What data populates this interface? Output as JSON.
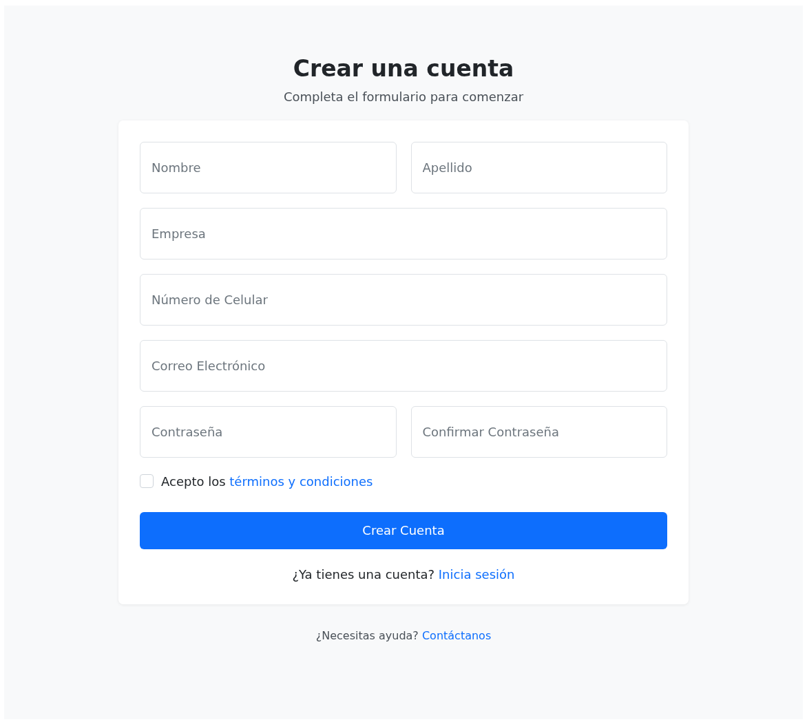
{
  "title": "Crear una cuenta",
  "subtitle": "Completa el formulario para comenzar",
  "form": {
    "rows": [
      [
        {
          "placeholder": "Nombre"
        },
        {
          "placeholder": "Apellido"
        }
      ],
      [
        {
          "placeholder": "Empresa"
        }
      ],
      [
        {
          "placeholder": "Número de Celular"
        }
      ],
      [
        {
          "placeholder": "Correo Electrónico"
        }
      ],
      [
        {
          "placeholder": "Contraseña"
        },
        {
          "placeholder": "Confirmar Contraseña"
        }
      ]
    ],
    "terms": {
      "checked": false,
      "text": "Acepto los",
      "link": "términos y condiciones"
    },
    "submit": "Crear Cuenta",
    "login": {
      "text": "¿Ya tienes una cuenta?",
      "link": "Inicia sesión"
    }
  },
  "footer": {
    "text": "¿Necesitas ayuda?",
    "link": "Contáctanos"
  }
}
